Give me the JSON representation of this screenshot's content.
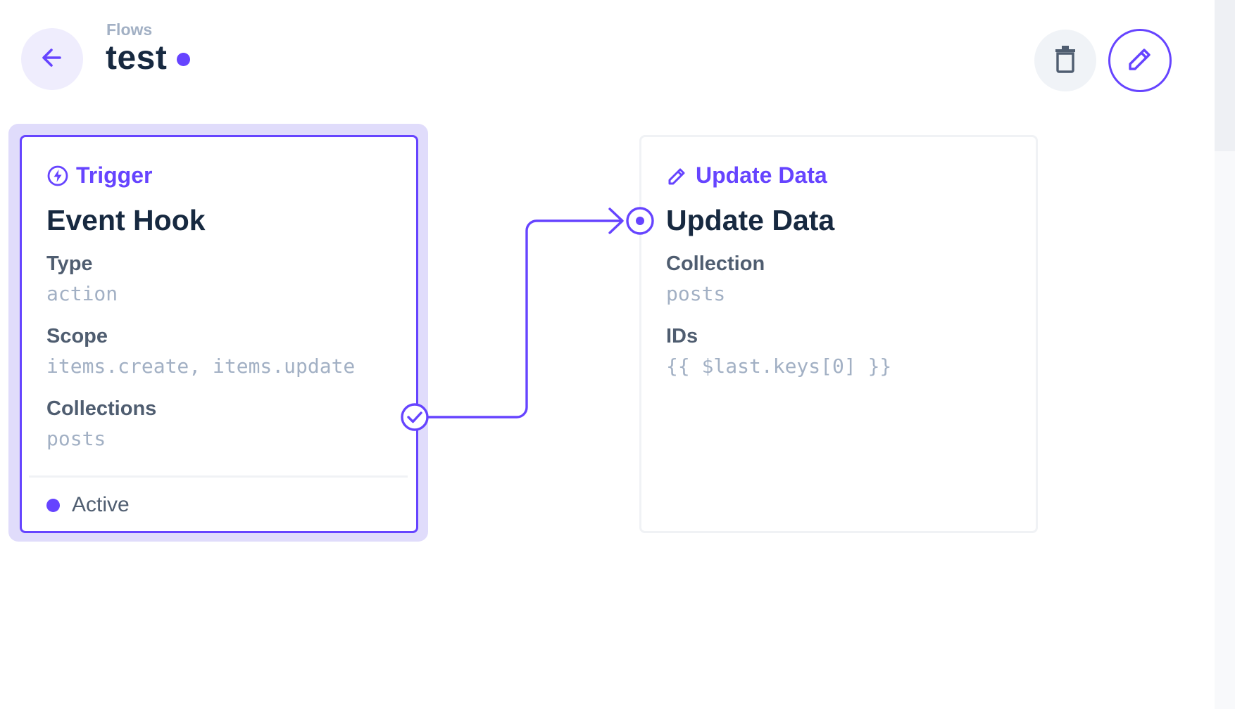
{
  "header": {
    "breadcrumb": "Flows",
    "title": "test",
    "status_color": "#6644ff"
  },
  "icons": {
    "back": "arrow-left-icon",
    "delete": "trash-icon",
    "edit": "pencil-icon",
    "trigger": "bolt-circle-icon",
    "operation": "pencil-icon",
    "resolve_handle": "check-circle-icon",
    "input_handle": "target-dot-icon"
  },
  "colors": {
    "accent": "#6644ff",
    "accent_light": "#e0dcfb",
    "title": "#172940",
    "label": "#4f5d70",
    "muted": "#a2b0c4"
  },
  "trigger": {
    "header": "Trigger",
    "name": "Event Hook",
    "fields": [
      {
        "label": "Type",
        "value": "action"
      },
      {
        "label": "Scope",
        "value": "items.create, items.update"
      },
      {
        "label": "Collections",
        "value": "posts"
      }
    ],
    "status_label": "Active"
  },
  "operation": {
    "header": "Update Data",
    "name": "Update Data",
    "fields": [
      {
        "label": "Collection",
        "value": "posts"
      },
      {
        "label": "IDs",
        "value": "{{ $last.keys[0] }}"
      }
    ]
  }
}
